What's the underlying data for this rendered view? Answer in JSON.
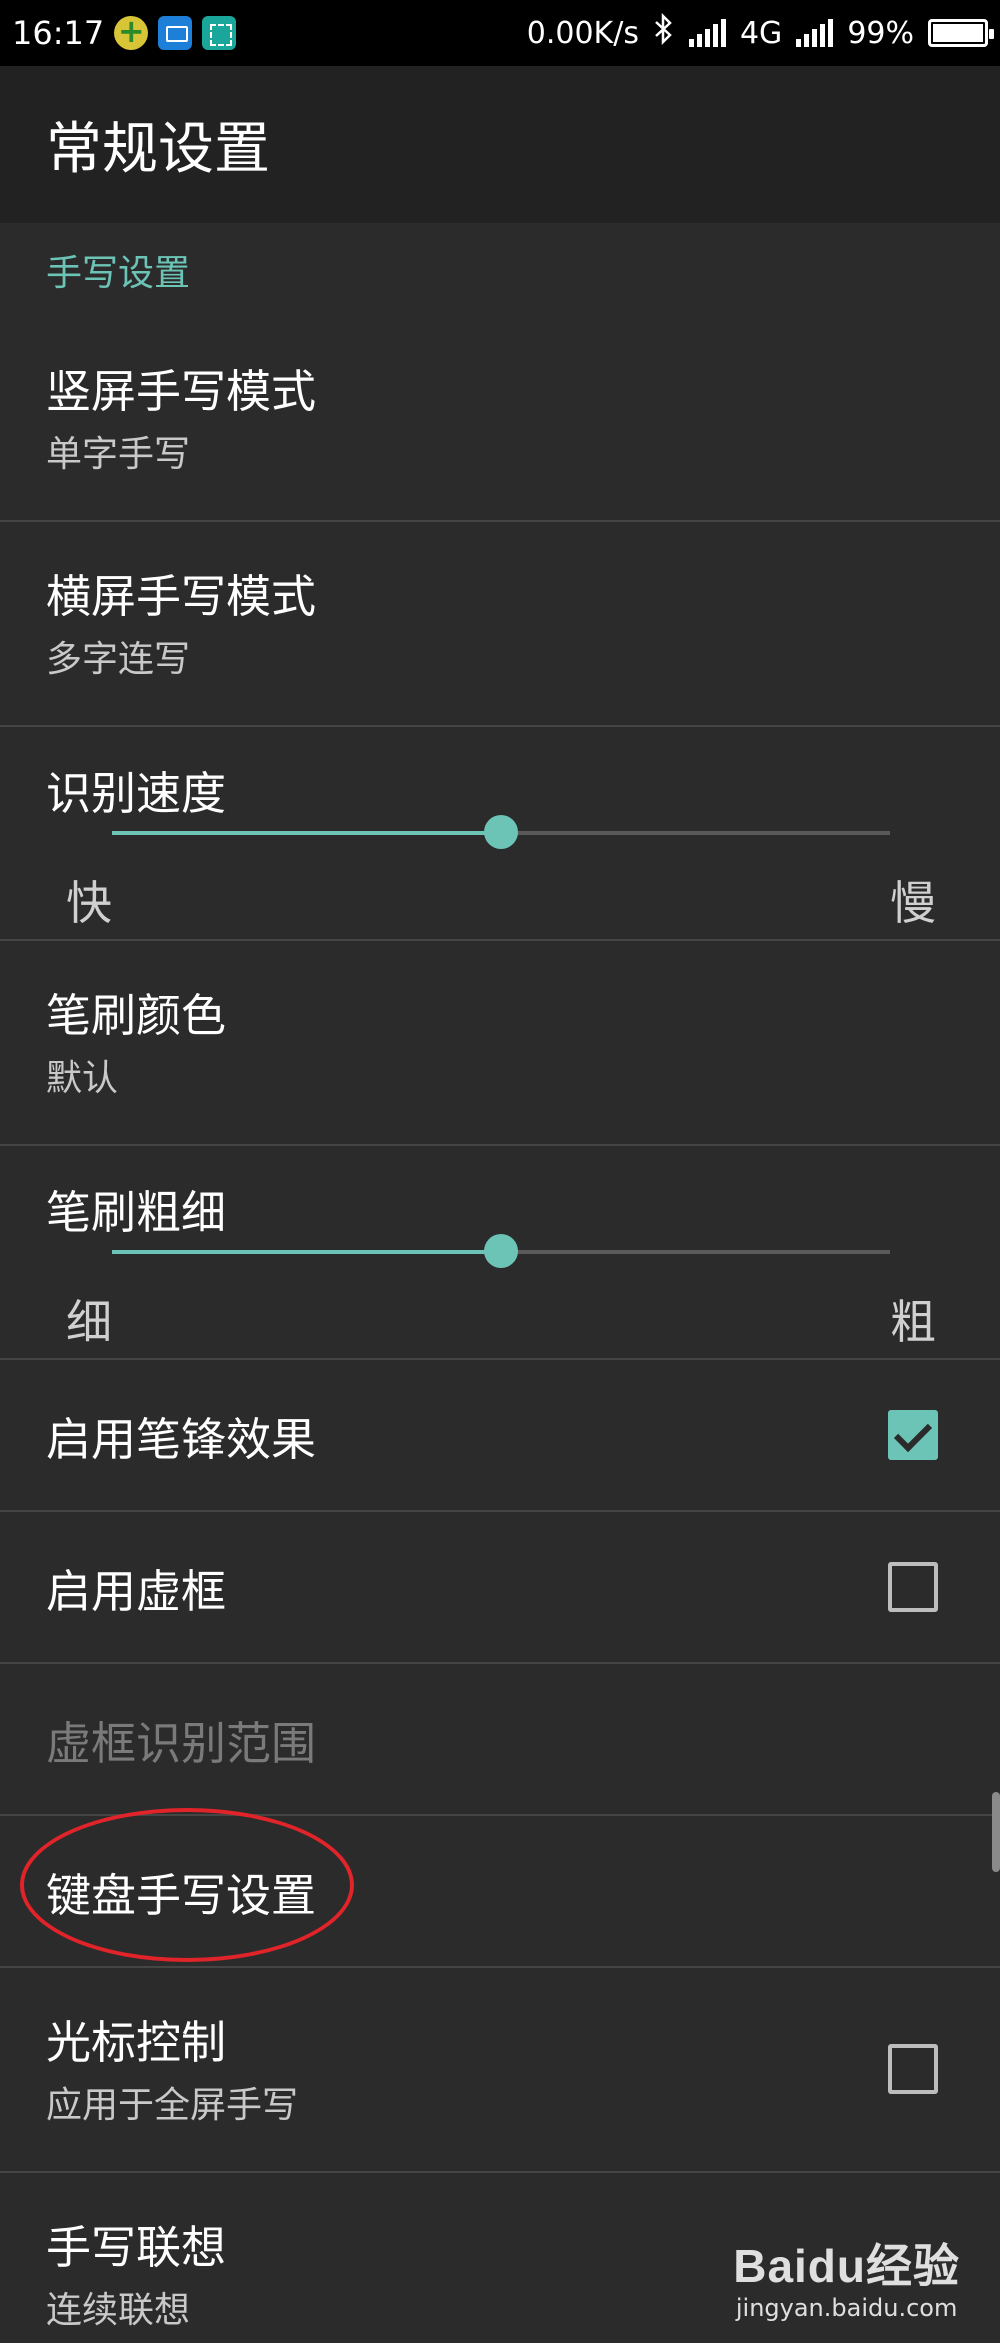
{
  "status_bar": {
    "time": "16:17",
    "net_speed": "0.00K/s",
    "network_type": "4G",
    "battery": "99%",
    "battery_level": 0.99,
    "icons": [
      "bluetooth-icon",
      "signal-icon",
      "battery-icon"
    ]
  },
  "app_bar": {
    "title": "常规设置"
  },
  "section": {
    "header": "手写设置"
  },
  "items": {
    "portrait_mode": {
      "title": "竖屏手写模式",
      "summary": "单字手写"
    },
    "landscape_mode": {
      "title": "横屏手写模式",
      "summary": "多字连写"
    },
    "recognition_speed": {
      "title": "识别速度",
      "min_label": "快",
      "max_label": "慢",
      "value": 0.5
    },
    "brush_color": {
      "title": "笔刷颜色",
      "summary": "默认"
    },
    "brush_width": {
      "title": "笔刷粗细",
      "min_label": "细",
      "max_label": "粗",
      "value": 0.5
    },
    "stroke_effect": {
      "title": "启用笔锋效果",
      "checked": true
    },
    "virtual_box": {
      "title": "启用虚框",
      "checked": false
    },
    "virtual_box_range": {
      "title": "虚框识别范围",
      "enabled": false
    },
    "keyboard_handwriting": {
      "title": "键盘手写设置"
    },
    "cursor_control": {
      "title": "光标控制",
      "summary": "应用于全屏手写",
      "checked": false
    },
    "handwriting_association": {
      "title": "手写联想",
      "summary": "连续联想"
    }
  },
  "colors": {
    "accent": "#6cc4b6",
    "background": "#2b2b2b",
    "annotation": "#e0242a"
  },
  "watermark": {
    "logo": "Baidu经验",
    "url": "jingyan.baidu.com"
  }
}
